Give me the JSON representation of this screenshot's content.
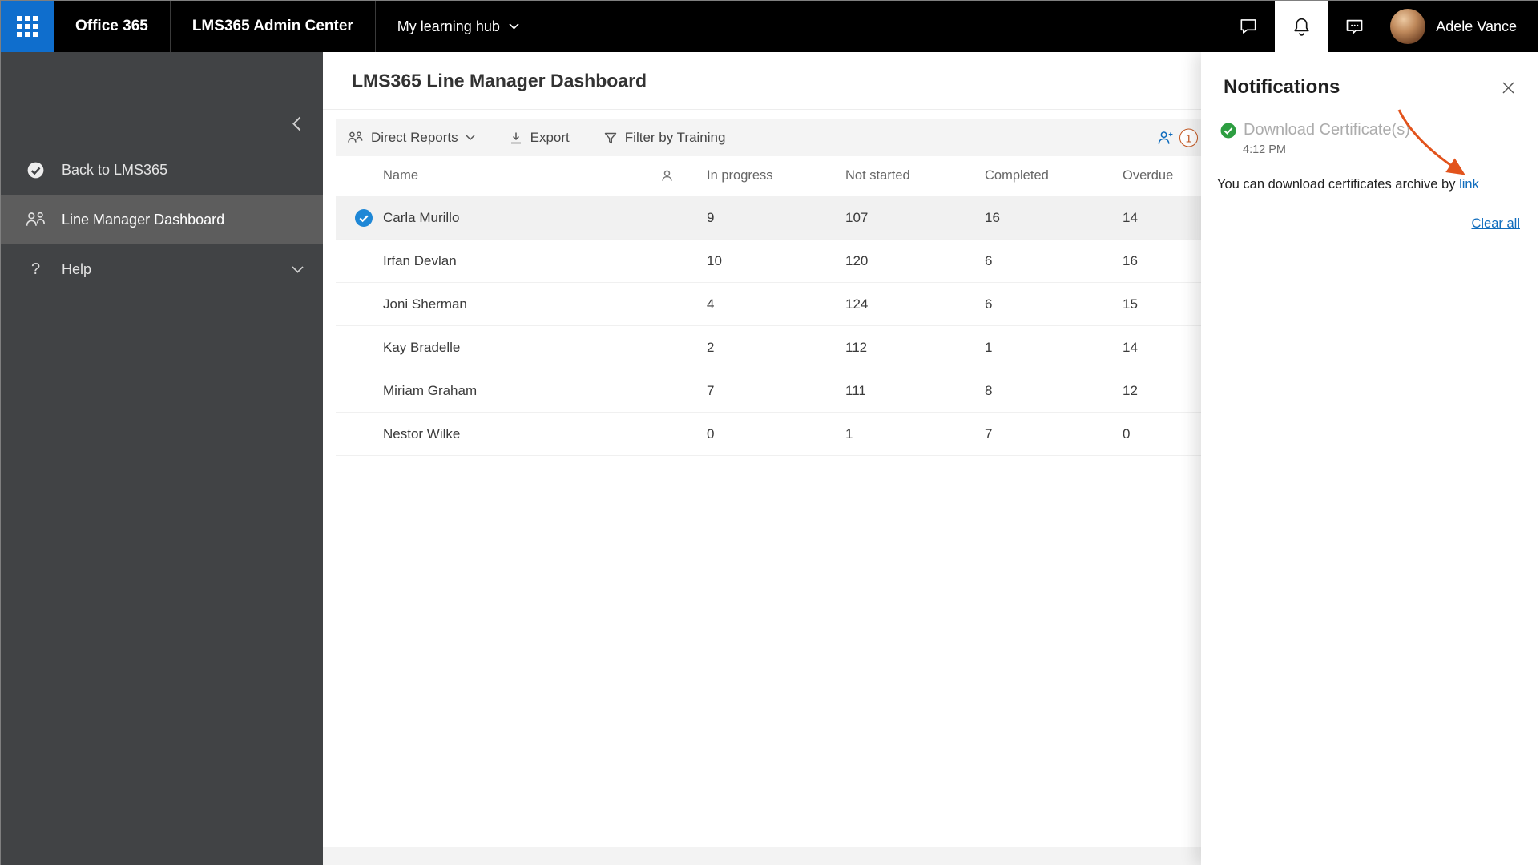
{
  "topbar": {
    "product": "Office 365",
    "section": "LMS365 Admin Center",
    "hub": "My learning hub",
    "user": "Adele Vance"
  },
  "sidebar": {
    "back": "Back to LMS365",
    "dashboard": "Line Manager Dashboard",
    "help": "Help"
  },
  "main": {
    "title": "LMS365 Line Manager Dashboard"
  },
  "toolbar": {
    "direct_reports": "Direct Reports",
    "export": "Export",
    "filter": "Filter by Training",
    "badge": "1"
  },
  "table": {
    "columns": [
      "Name",
      "In progress",
      "Not started",
      "Completed",
      "Overdue"
    ],
    "rows": [
      {
        "name": "Carla Murillo",
        "in_progress": "9",
        "not_started": "107",
        "completed": "16",
        "overdue": "14"
      },
      {
        "name": "Irfan Devlan",
        "in_progress": "10",
        "not_started": "120",
        "completed": "6",
        "overdue": "16"
      },
      {
        "name": "Joni Sherman",
        "in_progress": "4",
        "not_started": "124",
        "completed": "6",
        "overdue": "15"
      },
      {
        "name": "Kay Bradelle",
        "in_progress": "2",
        "not_started": "112",
        "completed": "1",
        "overdue": "14"
      },
      {
        "name": "Miriam Graham",
        "in_progress": "7",
        "not_started": "111",
        "completed": "8",
        "overdue": "12"
      },
      {
        "name": "Nestor Wilke",
        "in_progress": "0",
        "not_started": "1",
        "completed": "7",
        "overdue": "0"
      }
    ]
  },
  "notifications": {
    "title": "Notifications",
    "item_title": "Download Certificate(s)",
    "item_time": "4:12 PM",
    "item_body": "You can download certificates archive by ",
    "item_link": "link",
    "clear_all": "Clear all"
  },
  "colors": {
    "launcher_blue": "#0f6ecd",
    "link_blue": "#0f6cbd",
    "success_green": "#2d9e41",
    "annotation_orange": "#e2531c",
    "badge_orange": "#c4561f"
  }
}
